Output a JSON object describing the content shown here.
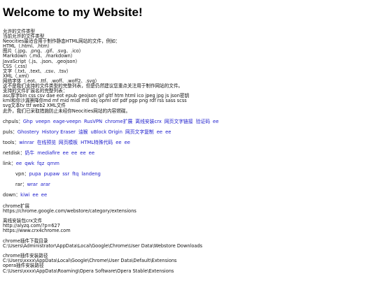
{
  "title": "Welcome to my Website!",
  "intro_lines": [
    "允许的文件类型",
    "当前允许的文件类型",
    "Neocities最适合用于制作静态HTML网站的文件，例如：",
    "HTML（.html、.htm）",
    "图片（.jpg、.png、.gif、.svg、.ico）",
    "Markdown（.md、.markdown）",
    "JavaScript（.js、.json、.geojson）",
    "CSS（.css）",
    "文字（.txt、.text、.csv、.tsv）",
    "XML（.xml）",
    "网络字体（.eot、.ttf、.woff、.woff2、.svg）",
    "这不是我们支持的文件类型的完整列表，但是仍然建议您重点关注用于制作网站的文件。",
    "支持的文件扩展名的完整列表：",
    "asc厚字bin css csv dae eot epub geojson gif gltf htm html ico jpeg jpg js json密钥",
    "kml和你沙漏箫降你md mf mid midi mtl obj opml otf pdf pgp png rdf rss sass scss",
    "svg文本tv ttf web2 XML文件",
    "此外，我们已采取措施防止未经你Neocities网站的内容燃碟。"
  ],
  "rows": [
    {
      "label": "chpuls：",
      "links": [
        "Ghp",
        "veepn",
        "eage-veepn",
        "RusVPN",
        "chrome扩展",
        "离线安装crx",
        "网页文字链接",
        "验证码",
        "ee"
      ]
    },
    {
      "label": "puls：",
      "links": [
        "Ghostery",
        "History Eraser",
        "油猴",
        "uBlock Origin",
        "网页文字复制",
        "ee",
        "ee"
      ]
    },
    {
      "label": "tools：",
      "links": [
        "winrar",
        "在线预览",
        "网页模板",
        "HTML特殊代码",
        "ee",
        "ee"
      ]
    },
    {
      "label": "netdisk：",
      "links": [
        "奶牛",
        "mediafire",
        "ee",
        "ee",
        "ee",
        "ee"
      ]
    },
    {
      "label": "link：",
      "links": [
        "ee",
        "qwk",
        "fqz",
        "qmm"
      ]
    }
  ],
  "indented_rows": [
    {
      "label": "vpn：",
      "links": [
        "pupa",
        "pupaw",
        "ssr",
        "ftq",
        "landeng"
      ]
    },
    {
      "label": "rar：",
      "links": [
        "wrar",
        "arar"
      ]
    }
  ],
  "down_row": {
    "label": "down：",
    "links": [
      "kiwi",
      "ee",
      "ee"
    ]
  },
  "info_blocks": [
    [
      "chrome扩展",
      "https://chrome.google.com/webstore/category/extensions"
    ],
    [
      "离线安装包crx文件",
      "http://alyzq.com/?p=627",
      "https://www.crx4chrome.com"
    ],
    [
      "chrome插件下载目录",
      "C:\\Users\\Administrator\\AppData\\Local\\Google\\Chrome\\User Data\\Webstore Downloads"
    ],
    [
      "chrome插件安装路径",
      "C:\\Users\\xxxx\\AppData\\Local\\Google\\Chrome\\User Data\\Default\\Extensions",
      "opera插件安装路径",
      "C:\\Users\\xxxx\\AppData\\Roaming\\Opera Software\\Opera Stable\\Extensions"
    ]
  ],
  "colors": {
    "link": "#1a1acc",
    "text": "#111111",
    "background": "#ffffff"
  }
}
